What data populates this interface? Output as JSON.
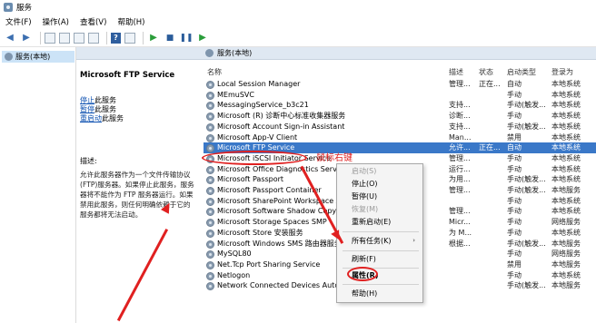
{
  "window": {
    "title": "服务"
  },
  "menu": [
    "文件(F)",
    "操作(A)",
    "查看(V)",
    "帮助(H)"
  ],
  "tree": {
    "node_label": "服务(本地)"
  },
  "panel_header": "服务(本地)",
  "detail": {
    "service_name": "Microsoft FTP Service",
    "actions": [
      {
        "link": "停止",
        "suffix": "此服务"
      },
      {
        "link": "暂停",
        "suffix": "此服务"
      },
      {
        "link": "重启动",
        "suffix": "此服务"
      }
    ],
    "desc_label": "描述:",
    "desc_lines": [
      "允许此服务器作为一个文件传输协议",
      "(FTP)服务器。如果停止此服务，服务",
      "器将不能作为 FTP 服务器运行。如果",
      "禁用此服务，则任何明确依赖于它的",
      "服务都将无法启动。"
    ]
  },
  "columns": {
    "name": "名称",
    "desc": "描述",
    "status": "状态",
    "startup": "启动类型",
    "logon": "登录为"
  },
  "services": [
    {
      "name": "Local Session Manager",
      "desc": "管理...",
      "status": "正在...",
      "startup": "自动",
      "logon": "本地系统"
    },
    {
      "name": "MEmuSVC",
      "desc": "",
      "status": "",
      "startup": "手动",
      "logon": "本地系统"
    },
    {
      "name": "MessagingService_b3c21",
      "desc": "支持...",
      "status": "",
      "startup": "手动(触发...",
      "logon": "本地系统"
    },
    {
      "name": "Microsoft (R) 诊断中心标准收集器服务",
      "desc": "诊断...",
      "status": "",
      "startup": "手动",
      "logon": "本地系统"
    },
    {
      "name": "Microsoft Account Sign-in Assistant",
      "desc": "支持...",
      "status": "",
      "startup": "手动(触发...",
      "logon": "本地系统"
    },
    {
      "name": "Microsoft App-V Client",
      "desc": "Man...",
      "status": "",
      "startup": "禁用",
      "logon": "本地系统"
    },
    {
      "name": "Microsoft FTP Service",
      "desc": "允许...",
      "status": "正在...",
      "startup": "自动",
      "logon": "本地系统"
    },
    {
      "name": "Microsoft iSCSI Initiator Service",
      "desc": "管理...",
      "status": "",
      "startup": "手动",
      "logon": "本地系统"
    },
    {
      "name": "Microsoft Office Diagnostics Service",
      "desc": "运行...",
      "status": "",
      "startup": "手动",
      "logon": "本地系统"
    },
    {
      "name": "Microsoft Passport",
      "desc": "为用...",
      "status": "",
      "startup": "手动(触发...",
      "logon": "本地系统"
    },
    {
      "name": "Microsoft Passport Container",
      "desc": "管理...",
      "status": "",
      "startup": "手动(触发...",
      "logon": "本地服务"
    },
    {
      "name": "Microsoft SharePoint Workspace Audit Service",
      "desc": "",
      "status": "",
      "startup": "手动",
      "logon": "本地系统"
    },
    {
      "name": "Microsoft Software Shadow Copy Provider",
      "desc": "管理...",
      "status": "",
      "startup": "手动",
      "logon": "本地系统"
    },
    {
      "name": "Microsoft Storage Spaces SMP",
      "desc": "Micr...",
      "status": "",
      "startup": "手动",
      "logon": "网络服务"
    },
    {
      "name": "Microsoft Store 安装服务",
      "desc": "为 M...",
      "status": "",
      "startup": "手动",
      "logon": "本地系统"
    },
    {
      "name": "Microsoft Windows SMS 路由器服务",
      "desc": "根据...",
      "status": "",
      "startup": "手动(触发...",
      "logon": "本地服务"
    },
    {
      "name": "MySQL80",
      "desc": "",
      "status": "",
      "startup": "手动",
      "logon": "网络服务"
    },
    {
      "name": "Net.Tcp Port Sharing Service",
      "desc": "",
      "status": "",
      "startup": "禁用",
      "logon": "本地服务"
    },
    {
      "name": "Netlogon",
      "desc": "",
      "status": "",
      "startup": "手动",
      "logon": "本地系统"
    },
    {
      "name": "Network Connected Devices Auto-Setup",
      "desc": "",
      "status": "",
      "startup": "手动(触发...",
      "logon": "本地服务"
    }
  ],
  "context_menu": {
    "items": [
      "启动(S)",
      "停止(O)",
      "暂停(U)",
      "恢复(M)",
      "重新启动(E)",
      "所有任务(K)",
      "刷新(F)",
      "属性(R)",
      "帮助(H)"
    ]
  },
  "annotation": {
    "text": "鼠标右键",
    "color": "#e02020"
  },
  "colors": {
    "selection": "#3a78c8",
    "link": "#0b4fb0",
    "annotation": "#e02020"
  }
}
